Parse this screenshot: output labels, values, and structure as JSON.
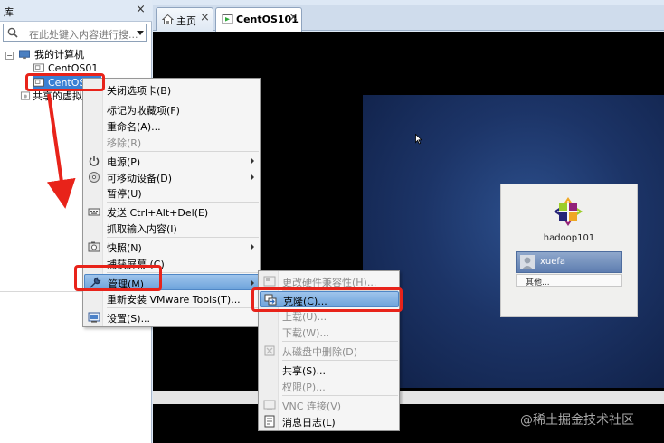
{
  "library": {
    "title": "库",
    "search_placeholder": "在此处键入内容进行搜...",
    "tree": {
      "root": "我的计算机",
      "vm1": "CentOS01",
      "vm2": "CentOS",
      "shared": "共享的虚拟机"
    }
  },
  "tabs": [
    {
      "label": "主页"
    },
    {
      "label": "CentOS101"
    }
  ],
  "vm_screen": {
    "hostname": "hadoop101",
    "user": "xuefa",
    "other": "其他..."
  },
  "context_menu": {
    "items": [
      {
        "label": "关闭选项卡(B)",
        "icon": "none"
      },
      {
        "label": "标记为收藏项(F)",
        "icon": "none"
      },
      {
        "label": "重命名(A)...",
        "icon": "none"
      },
      {
        "label": "移除(R)",
        "icon": "none",
        "disabled": true
      },
      {
        "label": "电源(P)",
        "icon": "power-icon",
        "submenu": true
      },
      {
        "label": "可移动设备(D)",
        "icon": "disc-icon",
        "submenu": true
      },
      {
        "label": "暂停(U)",
        "icon": "none"
      },
      {
        "label": "发送 Ctrl+Alt+Del(E)",
        "icon": "keyboard-icon"
      },
      {
        "label": "抓取输入内容(I)",
        "icon": "none"
      },
      {
        "label": "快照(N)",
        "icon": "snapshot-icon",
        "submenu": true
      },
      {
        "label": "捕获屏幕 (C)",
        "icon": "none"
      },
      {
        "label": "管理(M)",
        "icon": "wrench-icon",
        "submenu": true,
        "highlighted": true
      },
      {
        "label": "重新安装 VMware Tools(T)...",
        "icon": "none"
      },
      {
        "label": "设置(S)...",
        "icon": "settings-icon"
      }
    ]
  },
  "submenu": {
    "items": [
      {
        "label": "更改硬件兼容性(H)...",
        "icon": "compat-icon",
        "disabled": true
      },
      {
        "label": "克隆(C)...",
        "icon": "clone-icon",
        "highlighted": true
      },
      {
        "label": "上载(U)...",
        "icon": "none",
        "disabled": true
      },
      {
        "label": "下载(W)...",
        "icon": "none",
        "disabled": true
      },
      {
        "label": "从磁盘中删除(D)",
        "icon": "delete-icon",
        "disabled": true
      },
      {
        "label": "共享(S)...",
        "icon": "none"
      },
      {
        "label": "权限(P)...",
        "icon": "none",
        "disabled": true
      },
      {
        "label": "VNC 连接(V)",
        "icon": "vnc-icon",
        "disabled": true
      },
      {
        "label": "消息日志(L)",
        "icon": "log-icon"
      }
    ]
  },
  "annotation_color": "#e8231a",
  "watermark": "@稀土掘金技术社区"
}
